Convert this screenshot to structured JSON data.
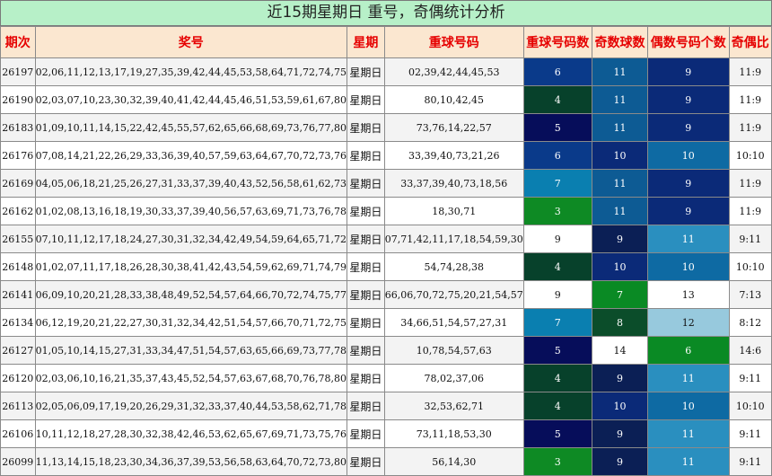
{
  "title": "近15期星期日 重号，奇偶统计分析",
  "headers": [
    "期次",
    "奖号",
    "星期",
    "重球号码",
    "重球号码数",
    "奇数球数",
    "偶数号码个数",
    "奇偶比"
  ],
  "colors": {
    "title_bg": "#b7f0c8",
    "header_bg": "#fbe7d0",
    "header_text": "#e60000",
    "scale": {
      "3": "#0e8a24",
      "4": "#07412b",
      "5": "#060d5a",
      "6": "#0a3a8a",
      "7": "#0a7fb0",
      "8": "#0b4d2a",
      "9": "#0b2a78",
      "10": "#0d5b94",
      "11": "#0e6aa3",
      "12": "#97c9dd",
      "13": "#ffffff",
      "14": "#ffffff"
    },
    "light_text_on": [
      "3",
      "4",
      "5",
      "6",
      "7",
      "8",
      "9",
      "10",
      "11"
    ]
  },
  "rows": [
    {
      "issue": "26197",
      "numbers": "02,06,11,12,13,17,19,27,35,39,42,44,45,53,58,64,71,72,74,75",
      "day": "星期日",
      "repeats": "02,39,42,44,45,53",
      "rep_count": "6",
      "odd": "11",
      "even": "9",
      "ratio": "11:9",
      "c_rep": "#0a3a8a",
      "c_odd": "#0d5b94",
      "c_even": "#0b2a78"
    },
    {
      "issue": "26190",
      "numbers": "02,03,07,10,23,30,32,39,40,41,42,44,45,46,51,53,59,61,67,80",
      "day": "星期日",
      "repeats": "80,10,42,45",
      "rep_count": "4",
      "odd": "11",
      "even": "9",
      "ratio": "11:9",
      "c_rep": "#07412b",
      "c_odd": "#0d5b94",
      "c_even": "#0b2a78"
    },
    {
      "issue": "26183",
      "numbers": "01,09,10,11,14,15,22,42,45,55,57,62,65,66,68,69,73,76,77,80",
      "day": "星期日",
      "repeats": "73,76,14,22,57",
      "rep_count": "5",
      "odd": "11",
      "even": "9",
      "ratio": "11:9",
      "c_rep": "#060d5a",
      "c_odd": "#0d5b94",
      "c_even": "#0b2a78"
    },
    {
      "issue": "26176",
      "numbers": "07,08,14,21,22,26,29,33,36,39,40,57,59,63,64,67,70,72,73,76",
      "day": "星期日",
      "repeats": "33,39,40,73,21,26",
      "rep_count": "6",
      "odd": "10",
      "even": "10",
      "ratio": "10:10",
      "c_rep": "#0a3a8a",
      "c_odd": "#0b2a78",
      "c_even": "#0e6aa3"
    },
    {
      "issue": "26169",
      "numbers": "04,05,06,18,21,25,26,27,31,33,37,39,40,43,52,56,58,61,62,73",
      "day": "星期日",
      "repeats": "33,37,39,40,73,18,56",
      "rep_count": "7",
      "odd": "11",
      "even": "9",
      "ratio": "11:9",
      "c_rep": "#0a7fb0",
      "c_odd": "#0d5b94",
      "c_even": "#0b2a78"
    },
    {
      "issue": "26162",
      "numbers": "01,02,08,13,16,18,19,30,33,37,39,40,56,57,63,69,71,73,76,78",
      "day": "星期日",
      "repeats": "18,30,71",
      "rep_count": "3",
      "odd": "11",
      "even": "9",
      "ratio": "11:9",
      "c_rep": "#0e8a24",
      "c_odd": "#0d5b94",
      "c_even": "#0b2a78"
    },
    {
      "issue": "26155",
      "numbers": "07,10,11,12,17,18,24,27,30,31,32,34,42,49,54,59,64,65,71,72",
      "day": "星期日",
      "repeats": "07,71,42,11,17,18,54,59,30",
      "rep_count": "9",
      "odd": "9",
      "even": "11",
      "ratio": "9:11",
      "c_rep": "#ffffff",
      "c_odd": "#0b1f55",
      "c_even": "#2a8fbf"
    },
    {
      "issue": "26148",
      "numbers": "01,02,07,11,17,18,26,28,30,38,41,42,43,54,59,62,69,71,74,79",
      "day": "星期日",
      "repeats": "54,74,28,38",
      "rep_count": "4",
      "odd": "10",
      "even": "10",
      "ratio": "10:10",
      "c_rep": "#07412b",
      "c_odd": "#0b2a78",
      "c_even": "#0e6aa3"
    },
    {
      "issue": "26141",
      "numbers": "06,09,10,20,21,28,33,38,48,49,52,54,57,64,66,70,72,74,75,77",
      "day": "星期日",
      "repeats": "66,06,70,72,75,20,21,54,57",
      "rep_count": "9",
      "odd": "7",
      "even": "13",
      "ratio": "7:13",
      "c_rep": "#ffffff",
      "c_odd": "#0a8a24",
      "c_even": "#ffffff"
    },
    {
      "issue": "26134",
      "numbers": "06,12,19,20,21,22,27,30,31,32,34,42,51,54,57,66,70,71,72,75",
      "day": "星期日",
      "repeats": "34,66,51,54,57,27,31",
      "rep_count": "7",
      "odd": "8",
      "even": "12",
      "ratio": "8:12",
      "c_rep": "#0a7fb0",
      "c_odd": "#0b4d2a",
      "c_even": "#97c9dd"
    },
    {
      "issue": "26127",
      "numbers": "01,05,10,14,15,27,31,33,34,47,51,54,57,63,65,66,69,73,77,78",
      "day": "星期日",
      "repeats": "10,78,54,57,63",
      "rep_count": "5",
      "odd": "14",
      "even": "6",
      "ratio": "14:6",
      "c_rep": "#060d5a",
      "c_odd": "#ffffff",
      "c_even": "#0a8a24"
    },
    {
      "issue": "26120",
      "numbers": "02,03,06,10,16,21,35,37,43,45,52,54,57,63,67,68,70,76,78,80",
      "day": "星期日",
      "repeats": "78,02,37,06",
      "rep_count": "4",
      "odd": "9",
      "even": "11",
      "ratio": "9:11",
      "c_rep": "#07412b",
      "c_odd": "#0b1f55",
      "c_even": "#2a8fbf"
    },
    {
      "issue": "26113",
      "numbers": "02,05,06,09,17,19,20,26,29,31,32,33,37,40,44,53,58,62,71,78",
      "day": "星期日",
      "repeats": "32,53,62,71",
      "rep_count": "4",
      "odd": "10",
      "even": "10",
      "ratio": "10:10",
      "c_rep": "#07412b",
      "c_odd": "#0b2a78",
      "c_even": "#0e6aa3"
    },
    {
      "issue": "26106",
      "numbers": "10,11,12,18,27,28,30,32,38,42,46,53,62,65,67,69,71,73,75,76",
      "day": "星期日",
      "repeats": "73,11,18,53,30",
      "rep_count": "5",
      "odd": "9",
      "even": "11",
      "ratio": "9:11",
      "c_rep": "#060d5a",
      "c_odd": "#0b1f55",
      "c_even": "#2a8fbf"
    },
    {
      "issue": "26099",
      "numbers": "11,13,14,15,18,23,30,34,36,37,39,53,56,58,63,64,70,72,73,80",
      "day": "星期日",
      "repeats": "56,14,30",
      "rep_count": "3",
      "odd": "9",
      "even": "11",
      "ratio": "9:11",
      "c_rep": "#0e8a24",
      "c_odd": "#0b1f55",
      "c_even": "#2a8fbf"
    }
  ]
}
